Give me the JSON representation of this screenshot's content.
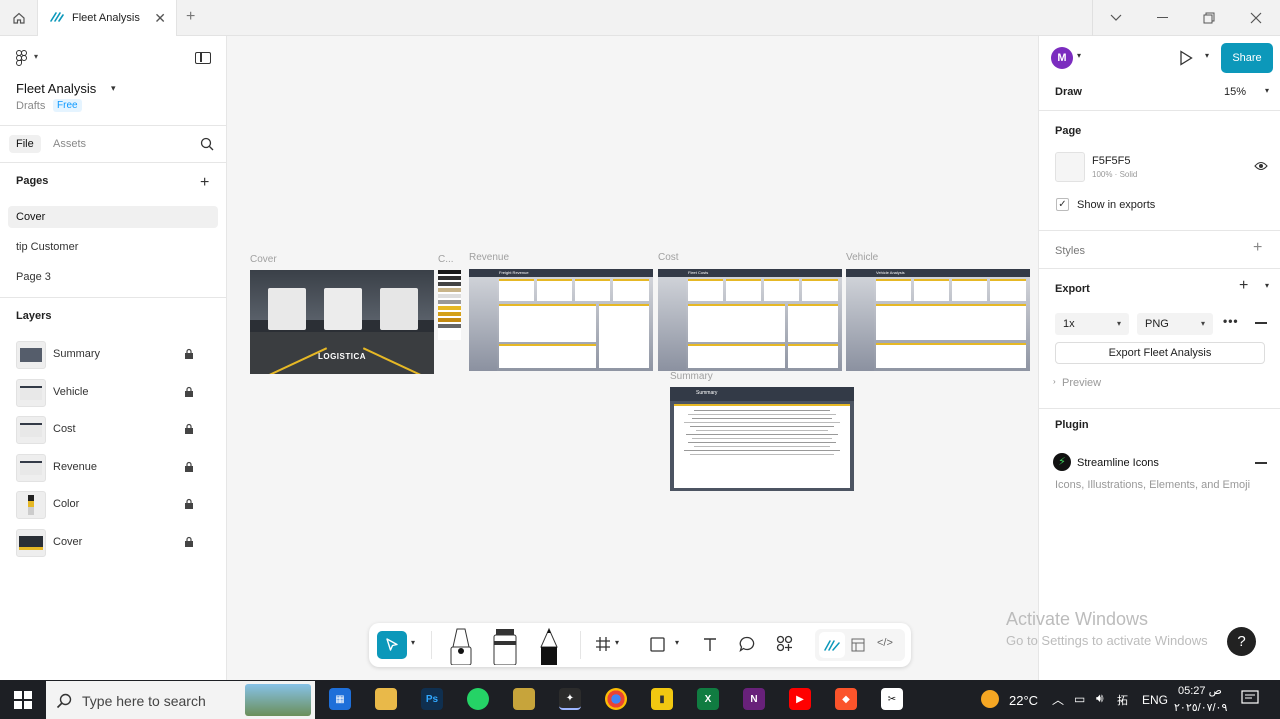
{
  "titlebar": {
    "tab_title": "Fleet Analysis"
  },
  "left_panel": {
    "file_name": "Fleet Analysis",
    "location": "Drafts",
    "plan_badge": "Free",
    "tabs": {
      "file": "File",
      "assets": "Assets"
    },
    "pages_title": "Pages",
    "pages": [
      "Cover",
      "tip Customer",
      "Page 3"
    ],
    "layers_title": "Layers",
    "layers": [
      "Summary",
      "Vehicle",
      "Cost",
      "Revenue",
      "Color",
      "Cover"
    ]
  },
  "canvas": {
    "frames": {
      "cover": "Cover",
      "color": "C...",
      "revenue": "Revenue",
      "cost": "Cost",
      "vehicle": "Vehicle",
      "summary": "Summary"
    },
    "cover_text": "LOGISTICA",
    "revenue_header": "Freight Revenue",
    "cost_header": "Fleet Costs",
    "vehicle_header": "Vehicle Analysis",
    "summary_header": "Summary"
  },
  "right_panel": {
    "avatar_letter": "M",
    "share_label": "Share",
    "draw_label": "Draw",
    "zoom": "15%",
    "page_title": "Page",
    "page_color": "F5F5F5",
    "page_fill_detail": "100% · Solid",
    "show_in_exports": "Show in exports",
    "styles_title": "Styles",
    "export_title": "Export",
    "export_scale": "1x",
    "export_format": "PNG",
    "export_button": "Export Fleet Analysis",
    "preview_label": "Preview",
    "plugin_title": "Plugin",
    "plugin_name": "Streamline Icons",
    "plugin_desc": "Icons, Illustrations, Elements, and Emoji"
  },
  "overlay": {
    "activate_title": "Activate Windows",
    "activate_sub": "Go to Settings to activate Windows",
    "help": "?"
  },
  "taskbar": {
    "search_placeholder": "Type here to search",
    "temperature": "22°C",
    "language": "ENG",
    "time": "05:27 ص",
    "date": "٢٠٢٥/٠٧/٠٩"
  },
  "colors": {
    "accent": "#0c98ba",
    "avatar": "#7b2cbf",
    "gold": "#e6b825",
    "dark_header": "#333a47"
  }
}
